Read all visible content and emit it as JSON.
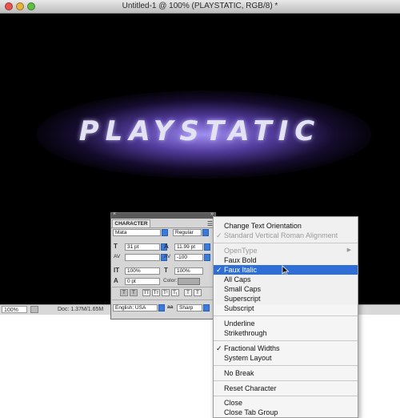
{
  "window": {
    "title": "Untitled-1 @ 100% (PLAYSTATIC, RGB/8) *"
  },
  "canvas": {
    "logo_text": "PLAYSTATIC"
  },
  "statusbar": {
    "zoom": "100%",
    "doc_info": "Doc: 1.37M/1.65M"
  },
  "character_panel": {
    "tab": "CHARACTER",
    "font_family": "Mata",
    "font_style": "Regular",
    "font_size": "31 pt",
    "leading": "11.99 pt",
    "kerning": "",
    "tracking": "-100",
    "vertical_scale": "100%",
    "horizontal_scale": "100%",
    "baseline_shift": "0 pt",
    "color_label": "Color:",
    "language": "English: USA",
    "aa_label": "a",
    "antialias": "Sharp",
    "type_buttons": [
      "T",
      "T",
      "TT",
      "Tт",
      "T¹",
      "T₁",
      "T",
      "T"
    ]
  },
  "context_menu": {
    "items": [
      {
        "label": "Change Text Orientation",
        "checked": false,
        "enabled": true,
        "highlighted": false
      },
      {
        "label": "Standard Vertical Roman Alignment",
        "checked": true,
        "enabled": false,
        "highlighted": false
      },
      {
        "label": "OpenType",
        "checked": false,
        "enabled": false,
        "highlighted": false,
        "submenu": true
      },
      {
        "label": "Faux Bold",
        "checked": false,
        "enabled": true,
        "highlighted": false
      },
      {
        "label": "Faux Italic",
        "checked": true,
        "enabled": true,
        "highlighted": true
      },
      {
        "label": "All Caps",
        "checked": false,
        "enabled": true,
        "highlighted": false
      },
      {
        "label": "Small Caps",
        "checked": false,
        "enabled": true,
        "highlighted": false
      },
      {
        "label": "Superscript",
        "checked": false,
        "enabled": true,
        "highlighted": false
      },
      {
        "label": "Subscript",
        "checked": false,
        "enabled": true,
        "highlighted": false
      },
      {
        "label": "Underline",
        "checked": false,
        "enabled": true,
        "highlighted": false
      },
      {
        "label": "Strikethrough",
        "checked": false,
        "enabled": true,
        "highlighted": false
      },
      {
        "label": "Fractional Widths",
        "checked": true,
        "enabled": true,
        "highlighted": false
      },
      {
        "label": "System Layout",
        "checked": false,
        "enabled": true,
        "highlighted": false
      },
      {
        "label": "No Break",
        "checked": false,
        "enabled": true,
        "highlighted": false
      },
      {
        "label": "Reset Character",
        "checked": false,
        "enabled": true,
        "highlighted": false
      },
      {
        "label": "Close",
        "checked": false,
        "enabled": true,
        "highlighted": false
      },
      {
        "label": "Close Tab Group",
        "checked": false,
        "enabled": true,
        "highlighted": false
      }
    ],
    "check_glyph": "✓",
    "submenu_glyph": "▶"
  },
  "colors": {
    "highlight": "#2f6ed6",
    "canvas": "#000000",
    "glow": "#8a6cf0"
  }
}
